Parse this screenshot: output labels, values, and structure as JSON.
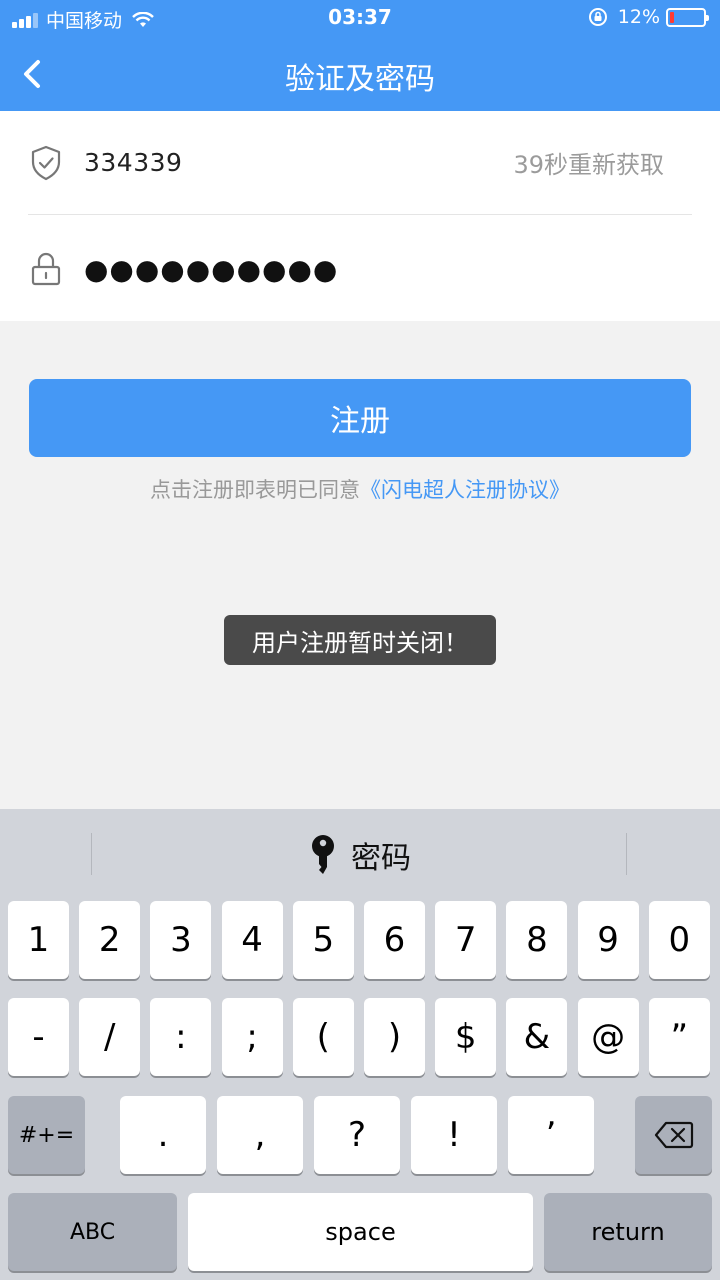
{
  "status_bar": {
    "carrier": "中国移动",
    "time": "03:37",
    "battery_percent": "12%",
    "battery_level": 0.12,
    "icons": [
      "signal-icon",
      "wifi-icon",
      "orientation-lock-icon",
      "battery-icon"
    ]
  },
  "nav": {
    "title": "验证及密码",
    "back_icon": "chevron-left-icon"
  },
  "form": {
    "code_value": "334339",
    "resend_label": "39秒重新获取",
    "password_value": "●●●●●●●●●●",
    "code_icon": "shield-check-icon",
    "password_icon": "lock-icon"
  },
  "register": {
    "button_label": "注册",
    "agreement_prefix": "点击注册即表明已同意",
    "agreement_link": "《闪电超人注册协议》"
  },
  "toast": {
    "message": "用户注册暂时关闭！"
  },
  "keyboard": {
    "suggestion": "密码",
    "suggestion_icon": "key-icon",
    "row1": [
      "1",
      "2",
      "3",
      "4",
      "5",
      "6",
      "7",
      "8",
      "9",
      "0"
    ],
    "row2": [
      "-",
      "/",
      ":",
      ";",
      "(",
      ")",
      "$",
      "&",
      "@",
      "”"
    ],
    "row3": {
      "symbols": "#+=",
      "keys": [
        ".",
        ",",
        "?",
        "!",
        "’"
      ],
      "delete_icon": "backspace-icon"
    },
    "row4": {
      "abc": "ABC",
      "space": "space",
      "return": "return"
    }
  },
  "colors": {
    "accent": "#4598f5",
    "toast_bg": "#4a4a4a",
    "keyboard_bg": "#d1d4da"
  }
}
